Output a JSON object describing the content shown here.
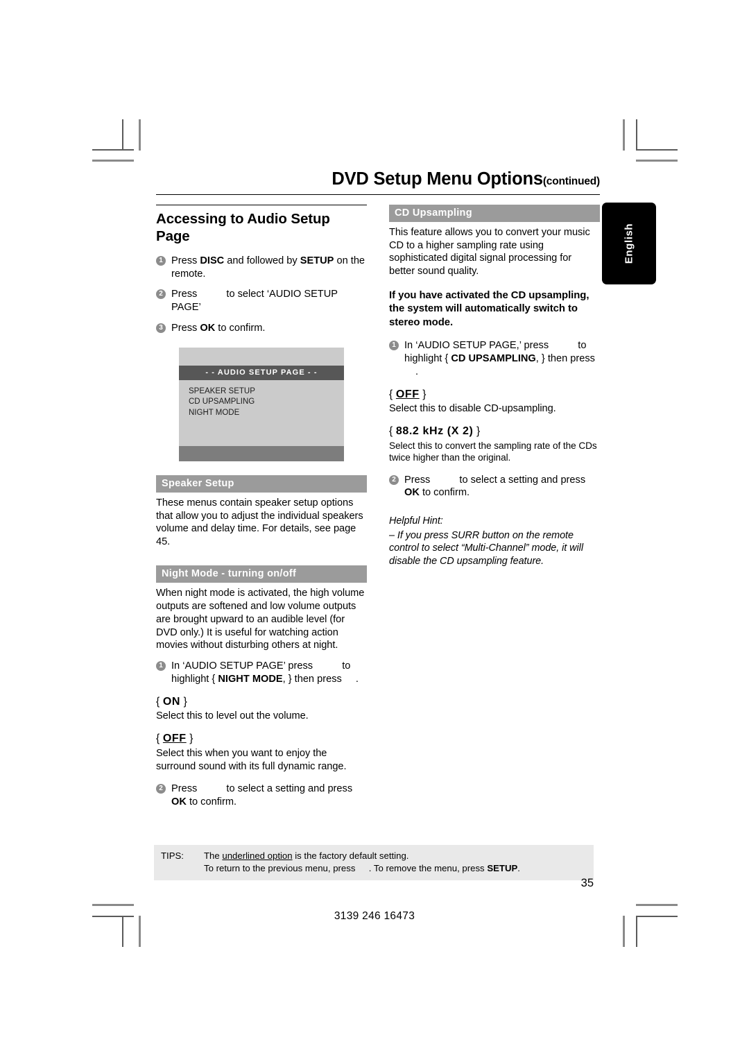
{
  "runhead": {
    "title": "DVD Setup Menu Options",
    "continued": "(continued)"
  },
  "thumb_tab": {
    "label": "English"
  },
  "left_column": {
    "heading": "Accessing to Audio Setup Page",
    "steps": [
      {
        "num": "1",
        "pre": "Press ",
        "bold1": "DISC",
        "mid": " and followed by ",
        "bold2": "SETUP",
        "post": " on the remote."
      },
      {
        "num": "2",
        "pre": "Press ",
        "post": " to select ‘AUDIO SETUP PAGE’"
      },
      {
        "num": "3",
        "pre": "Press ",
        "bold1": "OK",
        "post": " to confirm."
      }
    ],
    "tv_screen": {
      "title": "- -  AUDIO  SETUP  PAGE  - -",
      "menu_items": [
        "SPEAKER SETUP",
        "CD UPSAMPLING",
        "NIGHT MODE"
      ]
    },
    "speaker_setup": {
      "bar": "Speaker Setup",
      "body": "These menus contain speaker setup options that allow you to adjust the individual speakers volume and delay time. For details, see page 45."
    },
    "night_mode": {
      "bar": "Night Mode - turning on/off",
      "body": "When night mode is activated, the high volume outputs are softened and low volume outputs are brought upward to an audible level (for DVD only.)  It is useful for watching action movies without disturbing others at night.",
      "step1": {
        "num": "1",
        "pre": "In ‘AUDIO SETUP PAGE’ press ",
        "mid": " to highlight { ",
        "bold": "NIGHT MODE",
        "mid2": ", } then press ",
        "post": " ."
      },
      "options": [
        {
          "open": "{ ",
          "value": "ON",
          "close": " }",
          "underlined": false,
          "desc": "Select this to level out the volume."
        },
        {
          "open": "{ ",
          "value": "OFF",
          "close": " }",
          "underlined": true,
          "desc": "Select this when you want to enjoy the surround sound with its full dynamic range."
        }
      ],
      "step2": {
        "num": "2",
        "pre": "Press ",
        "mid": " to select a setting and press ",
        "bold": "OK",
        "post": " to confirm."
      }
    }
  },
  "right_column": {
    "cd_upsampling": {
      "bar": "CD Upsampling",
      "body": "This feature allows you to convert your music CD to a higher sampling rate using sophisticated digital signal processing for better sound quality.",
      "bold_note": "If you have activated the CD upsampling, the system will automatically switch to stereo mode.",
      "step1": {
        "num": "1",
        "pre": "In ‘AUDIO SETUP PAGE,’ press ",
        "mid": " to highlight { ",
        "bold": "CD UPSAMPLING",
        "mid2": ", } then press ",
        "post": " ."
      },
      "options": [
        {
          "open": "{ ",
          "value": "OFF",
          "close": " }",
          "underlined": true,
          "desc": "Select this to disable CD-upsampling."
        },
        {
          "open": "{ ",
          "value": "88.2 kHz (X 2)",
          "close": " }",
          "underlined": false,
          "desc": "Select this to convert the sampling rate of the CDs twice higher than the original."
        }
      ],
      "step2": {
        "num": "2",
        "pre": "Press ",
        "mid": " to select a setting and press ",
        "bold": "OK",
        "post": " to confirm."
      },
      "hint_title": "Helpful Hint:",
      "hint_body": "–  If you press SURR button on the remote control to select “Multi-Channel” mode, it will disable the CD upsampling feature."
    }
  },
  "tips": {
    "label": "TIPS:",
    "line1_pre": "The ",
    "line1_underlined": "underlined option",
    "line1_post": " is the factory default setting.",
    "line2_pre": "To return to the previous menu, press ",
    "line2_mid": " . To remove the menu, press ",
    "line2_bold": "SETUP",
    "line2_post": "."
  },
  "footer": {
    "page_number": "35",
    "document_code": "3139 246 16473"
  }
}
